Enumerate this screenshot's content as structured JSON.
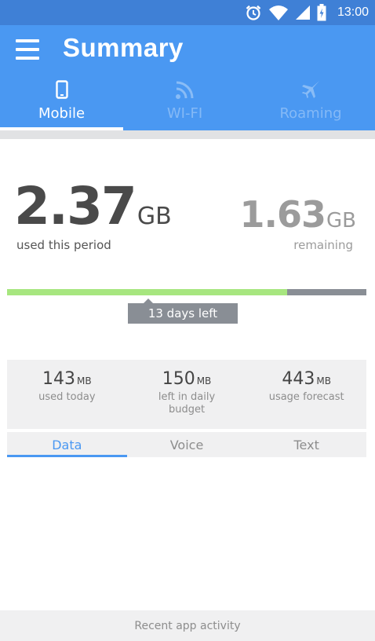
{
  "status_bar": {
    "time": "13:00",
    "icons": [
      "alarm-icon",
      "wifi-icon",
      "signal-icon",
      "battery-icon"
    ]
  },
  "header": {
    "title": "Summary",
    "menu_icon": "hamburger-menu-icon"
  },
  "tabs": [
    {
      "label": "Mobile",
      "icon": "phone-icon",
      "active": true
    },
    {
      "label": "WI-FI",
      "icon": "wifi-icon",
      "active": false
    },
    {
      "label": "Roaming",
      "icon": "airplane-icon",
      "active": false
    }
  ],
  "usage": {
    "used_value": "2.37",
    "used_unit": "GB",
    "used_label": "used this period",
    "remaining_value": "1.63",
    "remaining_unit": "GB",
    "remaining_label": "remaining",
    "progress_fraction": 0.7804,
    "days_left": "13 days left"
  },
  "stats": [
    {
      "value": "143",
      "unit": "MB",
      "label": "used today"
    },
    {
      "value": "150",
      "unit": "MB",
      "label": "left in daily budget"
    },
    {
      "value": "443",
      "unit": "MB",
      "label": "usage forecast"
    }
  ],
  "subtabs": [
    {
      "label": "Data",
      "active": true
    },
    {
      "label": "Voice",
      "active": false
    },
    {
      "label": "Text",
      "active": false
    }
  ],
  "footer": {
    "label": "Recent app activity"
  },
  "colors": {
    "status_bar": "#3f80d6",
    "app_bar": "#4a98f2",
    "progress_used": "#a7e67f",
    "progress_remaining": "#898e95",
    "accent": "#4a98f2"
  }
}
